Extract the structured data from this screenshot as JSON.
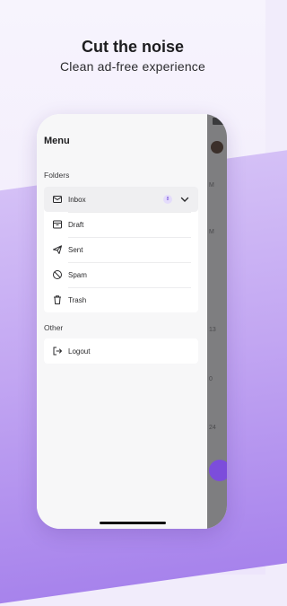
{
  "promo": {
    "headline": "Cut the noise",
    "subhead": "Clean ad-free experience"
  },
  "drawer": {
    "title": "Menu",
    "folders_label": "Folders",
    "folders": [
      {
        "label": "Inbox",
        "icon": "inbox-icon",
        "badge": "8",
        "selected": true
      },
      {
        "label": "Draft",
        "icon": "draft-icon"
      },
      {
        "label": "Sent",
        "icon": "send-icon"
      },
      {
        "label": "Spam",
        "icon": "spam-icon"
      },
      {
        "label": "Trash",
        "icon": "trash-icon"
      }
    ],
    "other_label": "Other",
    "other": [
      {
        "label": "Logout",
        "icon": "logout-icon"
      }
    ]
  },
  "background_list": {
    "fragments": [
      "M",
      "M",
      "13",
      "0",
      "24"
    ]
  },
  "colors": {
    "accent": "#7c4ddb",
    "badge_bg": "#e4dcfb",
    "background_purple": "#b898ef"
  }
}
